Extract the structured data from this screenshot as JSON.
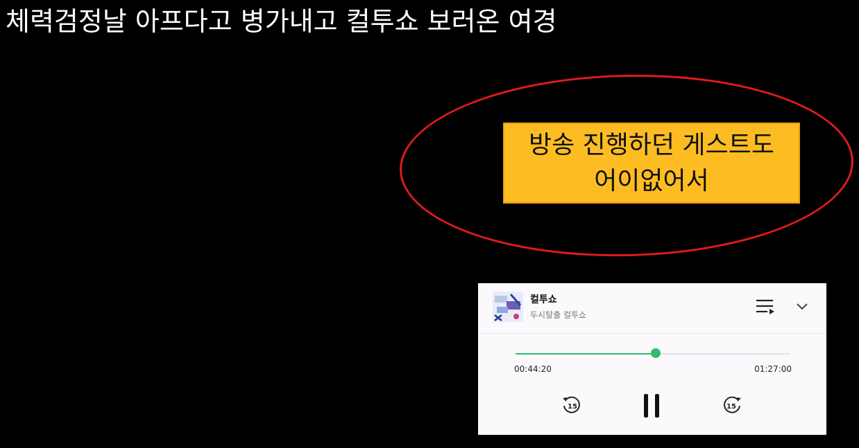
{
  "overlay": {
    "title": "체력검정날 아프다고 병가내고 컬투쇼 보러온 여경",
    "caption_line1": "방송 진행하던 게스트도",
    "caption_line2": "어이없어서"
  },
  "player": {
    "track_title": "컬투쇼",
    "track_subtitle": "두시탈출 컬투쇼",
    "elapsed": "00:44:20",
    "duration": "01:27:00",
    "progress_fraction": 0.51,
    "rewind_label": "15",
    "forward_label": "15",
    "accent_color": "#2fbe6e",
    "icons": {
      "queue": "queue-list-icon",
      "collapse": "chevron-down-icon",
      "rewind": "rewind-15-icon",
      "pause": "pause-icon",
      "forward": "forward-15-icon"
    }
  },
  "colors": {
    "background": "#000000",
    "caption_bg": "#fdbd22",
    "highlight_ellipse": "#e01b1b"
  }
}
